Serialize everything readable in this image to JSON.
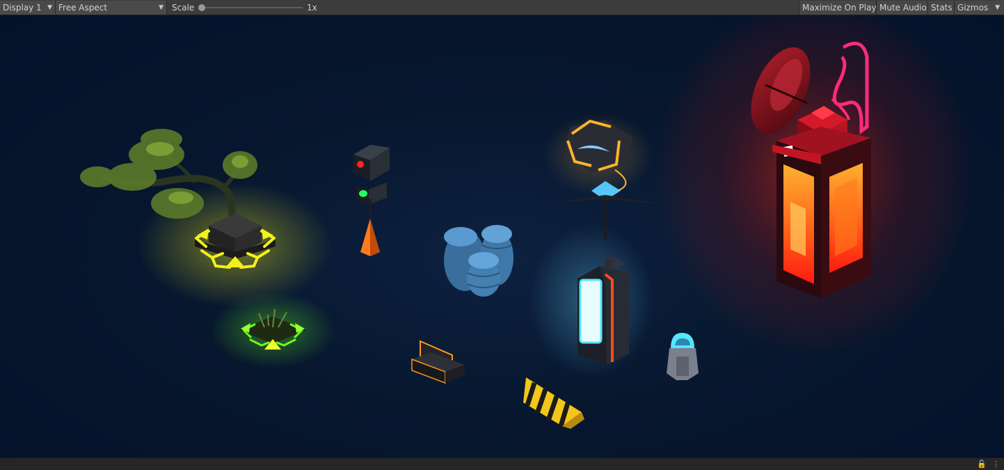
{
  "toolbar": {
    "display": {
      "label": "Display 1",
      "icon": "dropdown-caret"
    },
    "aspect": {
      "label": "Free Aspect",
      "icon": "dropdown-caret"
    },
    "scale": {
      "label": "Scale",
      "value_label": "1x",
      "value": 0
    },
    "buttons": {
      "maximize": "Maximize On Play",
      "mute": "Mute Audio",
      "stats": "Stats",
      "gizmos": "Gizmos"
    },
    "caret_glyph": "▼"
  },
  "statusbar": {
    "lock_icon": "lock-icon",
    "menu_icon": "kebab-menu-icon",
    "lock_glyph": "🔓",
    "menu_glyph": "⋮"
  },
  "scene": {
    "background": "#061530",
    "objects": [
      "tree-yellow-glow",
      "shrub-green-glow",
      "traffic-light",
      "barrels",
      "bench",
      "striped-barrier",
      "drone-sign",
      "vending-kiosk",
      "small-robot",
      "red-tower"
    ],
    "colors": {
      "yellow_glow": "#f5f01a",
      "green_glow": "#6aff1a",
      "red_glow": "#ff3a22",
      "pink_neon": "#ff2a7a",
      "cyan": "#55e6ff",
      "orange": "#ff7a1a",
      "barrel_blue": "#4a8ac2"
    }
  }
}
